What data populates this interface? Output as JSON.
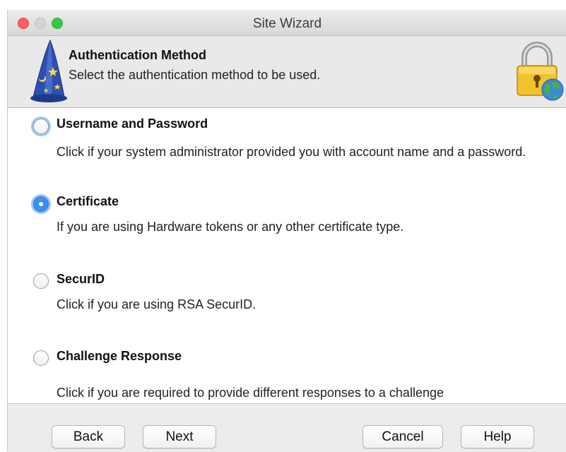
{
  "window": {
    "title": "Site Wizard"
  },
  "header": {
    "title": "Authentication Method",
    "subtitle": "Select the authentication method to be used."
  },
  "options": [
    {
      "label": "Username and Password",
      "description": "Click if your system administrator provided you with account name and a password.",
      "selected": false,
      "focused": true
    },
    {
      "label": "Certificate",
      "description": "If you are using Hardware tokens or any other certificate type.",
      "selected": true,
      "focused": false
    },
    {
      "label": "SecurID",
      "description": "Click if you are using RSA SecurID.",
      "selected": false,
      "focused": false
    },
    {
      "label": "Challenge Response",
      "description": "Click if you are required to provide different responses to a challenge",
      "selected": false,
      "focused": false
    }
  ],
  "buttons": {
    "back": "Back",
    "next": "Next",
    "cancel": "Cancel",
    "help": "Help"
  },
  "icons": {
    "wizard": "wizard-hat-icon",
    "lock": "lock-globe-icon"
  },
  "colors": {
    "radio_selected": "#3d8ef6",
    "focus_ring": "#9cc3f5"
  }
}
